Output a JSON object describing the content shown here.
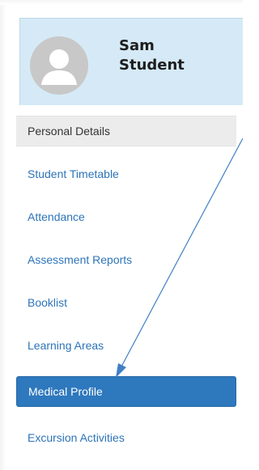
{
  "profile": {
    "first_name": "Sam",
    "last_name": "Student"
  },
  "sidebar": {
    "items": [
      {
        "label": "Personal Details",
        "state": "selected"
      },
      {
        "label": "Student Timetable",
        "state": "normal"
      },
      {
        "label": "Attendance",
        "state": "normal"
      },
      {
        "label": "Assessment Reports",
        "state": "normal"
      },
      {
        "label": "Booklist",
        "state": "normal"
      },
      {
        "label": "Learning Areas",
        "state": "normal"
      },
      {
        "label": "Medical Profile",
        "state": "highlighted"
      },
      {
        "label": "Excursion Activities",
        "state": "normal"
      }
    ]
  },
  "colors": {
    "profile_background": "#d5eaf6",
    "link": "#2d74b8",
    "selected_background": "#ececec",
    "highlight_background": "#2e78bd",
    "annotation_arrow": "#3f7fc4"
  },
  "icons": {
    "avatar": "user-silhouette-icon",
    "annotation": "pointer-arrow"
  }
}
